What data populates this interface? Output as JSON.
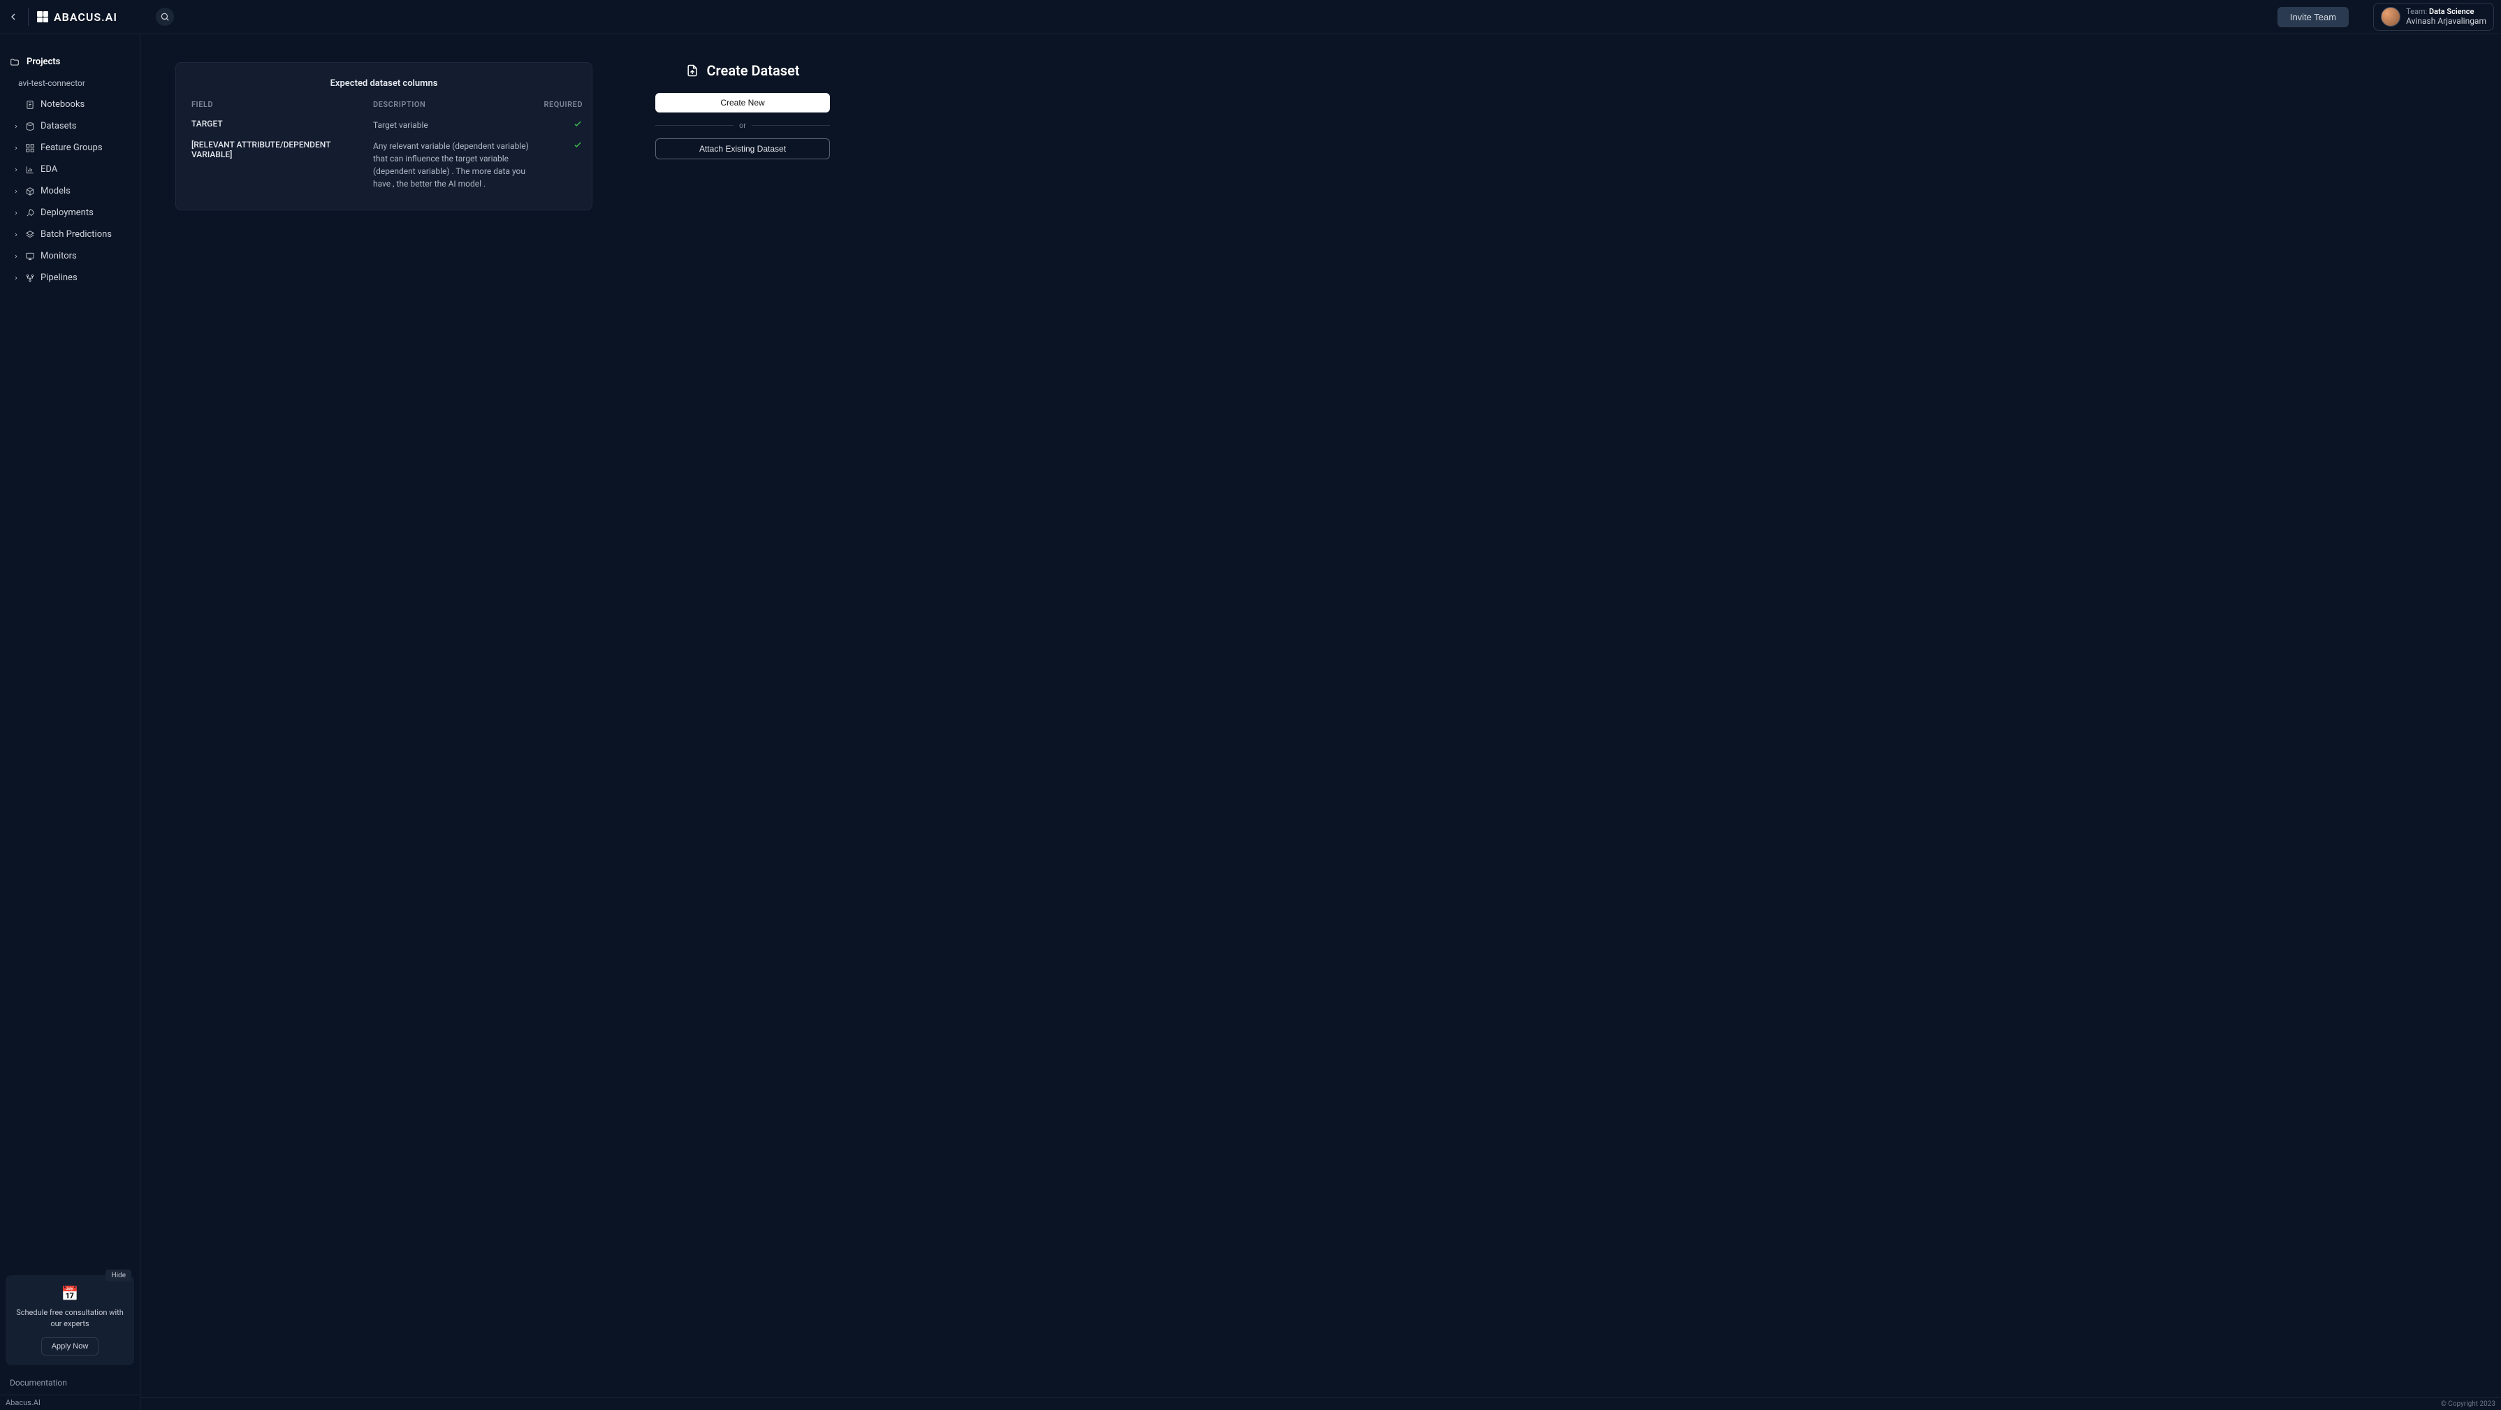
{
  "header": {
    "brand": "ABACUS.AI",
    "invite_label": "Invite Team",
    "team_label": "Team: ",
    "team_name": "Data Science",
    "user_name": "Avinash Arjavalingam"
  },
  "sidebar": {
    "root": "Projects",
    "project": "avi-test-connector",
    "items": [
      "Notebooks",
      "Datasets",
      "Feature Groups",
      "EDA",
      "Models",
      "Deployments",
      "Batch Predictions",
      "Monitors",
      "Pipelines"
    ],
    "consult": {
      "hide": "Hide",
      "text": "Schedule free consultation with our experts",
      "button": "Apply Now"
    },
    "doc": "Documentation",
    "brand_footer": "Abacus.AI"
  },
  "table": {
    "title": "Expected dataset columns",
    "headers": [
      "FIELD",
      "DESCRIPTION",
      "REQUIRED"
    ],
    "rows": [
      {
        "field": "TARGET",
        "desc": "Target variable",
        "req": true
      },
      {
        "field": "[RELEVANT ATTRIBUTE/DEPENDENT VARIABLE]",
        "desc": "Any relevant variable (dependent variable) that can influence the target variable (dependent variable) .  The more data you have ,  the better the AI model .",
        "req": true
      }
    ]
  },
  "create": {
    "title": "Create Dataset",
    "primary": "Create New",
    "or": "or",
    "secondary": "Attach Existing Dataset"
  },
  "footer": {
    "copyright": "© Copyright 2023"
  }
}
